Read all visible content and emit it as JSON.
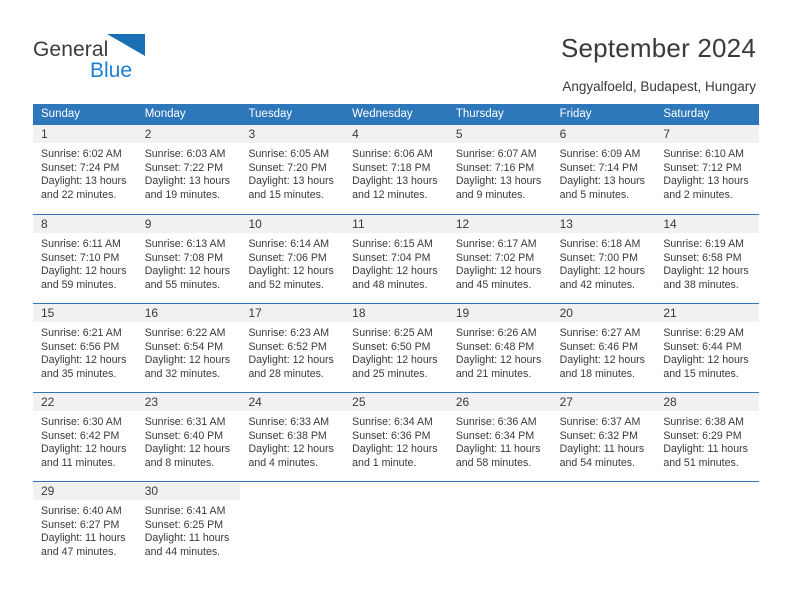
{
  "brand": {
    "name_part1": "General",
    "name_part2": "Blue",
    "logo_icon": "blue-triangle-icon",
    "accent_color": "#1b7fd4"
  },
  "header": {
    "title": "September 2024",
    "subtitle": "Angyalfoeld, Budapest, Hungary"
  },
  "colors": {
    "header_row_bg": "#2e77bb",
    "header_row_text": "#ffffff",
    "day_number_band_bg": "#f1f1f1",
    "cell_bg": "#ffffff",
    "text": "#3a3a3a"
  },
  "weekdays": [
    "Sunday",
    "Monday",
    "Tuesday",
    "Wednesday",
    "Thursday",
    "Friday",
    "Saturday"
  ],
  "weeks": [
    [
      {
        "day": "1",
        "sunrise": "Sunrise: 6:02 AM",
        "sunset": "Sunset: 7:24 PM",
        "daylight1": "Daylight: 13 hours",
        "daylight2": "and 22 minutes."
      },
      {
        "day": "2",
        "sunrise": "Sunrise: 6:03 AM",
        "sunset": "Sunset: 7:22 PM",
        "daylight1": "Daylight: 13 hours",
        "daylight2": "and 19 minutes."
      },
      {
        "day": "3",
        "sunrise": "Sunrise: 6:05 AM",
        "sunset": "Sunset: 7:20 PM",
        "daylight1": "Daylight: 13 hours",
        "daylight2": "and 15 minutes."
      },
      {
        "day": "4",
        "sunrise": "Sunrise: 6:06 AM",
        "sunset": "Sunset: 7:18 PM",
        "daylight1": "Daylight: 13 hours",
        "daylight2": "and 12 minutes."
      },
      {
        "day": "5",
        "sunrise": "Sunrise: 6:07 AM",
        "sunset": "Sunset: 7:16 PM",
        "daylight1": "Daylight: 13 hours",
        "daylight2": "and 9 minutes."
      },
      {
        "day": "6",
        "sunrise": "Sunrise: 6:09 AM",
        "sunset": "Sunset: 7:14 PM",
        "daylight1": "Daylight: 13 hours",
        "daylight2": "and 5 minutes."
      },
      {
        "day": "7",
        "sunrise": "Sunrise: 6:10 AM",
        "sunset": "Sunset: 7:12 PM",
        "daylight1": "Daylight: 13 hours",
        "daylight2": "and 2 minutes."
      }
    ],
    [
      {
        "day": "8",
        "sunrise": "Sunrise: 6:11 AM",
        "sunset": "Sunset: 7:10 PM",
        "daylight1": "Daylight: 12 hours",
        "daylight2": "and 59 minutes."
      },
      {
        "day": "9",
        "sunrise": "Sunrise: 6:13 AM",
        "sunset": "Sunset: 7:08 PM",
        "daylight1": "Daylight: 12 hours",
        "daylight2": "and 55 minutes."
      },
      {
        "day": "10",
        "sunrise": "Sunrise: 6:14 AM",
        "sunset": "Sunset: 7:06 PM",
        "daylight1": "Daylight: 12 hours",
        "daylight2": "and 52 minutes."
      },
      {
        "day": "11",
        "sunrise": "Sunrise: 6:15 AM",
        "sunset": "Sunset: 7:04 PM",
        "daylight1": "Daylight: 12 hours",
        "daylight2": "and 48 minutes."
      },
      {
        "day": "12",
        "sunrise": "Sunrise: 6:17 AM",
        "sunset": "Sunset: 7:02 PM",
        "daylight1": "Daylight: 12 hours",
        "daylight2": "and 45 minutes."
      },
      {
        "day": "13",
        "sunrise": "Sunrise: 6:18 AM",
        "sunset": "Sunset: 7:00 PM",
        "daylight1": "Daylight: 12 hours",
        "daylight2": "and 42 minutes."
      },
      {
        "day": "14",
        "sunrise": "Sunrise: 6:19 AM",
        "sunset": "Sunset: 6:58 PM",
        "daylight1": "Daylight: 12 hours",
        "daylight2": "and 38 minutes."
      }
    ],
    [
      {
        "day": "15",
        "sunrise": "Sunrise: 6:21 AM",
        "sunset": "Sunset: 6:56 PM",
        "daylight1": "Daylight: 12 hours",
        "daylight2": "and 35 minutes."
      },
      {
        "day": "16",
        "sunrise": "Sunrise: 6:22 AM",
        "sunset": "Sunset: 6:54 PM",
        "daylight1": "Daylight: 12 hours",
        "daylight2": "and 32 minutes."
      },
      {
        "day": "17",
        "sunrise": "Sunrise: 6:23 AM",
        "sunset": "Sunset: 6:52 PM",
        "daylight1": "Daylight: 12 hours",
        "daylight2": "and 28 minutes."
      },
      {
        "day": "18",
        "sunrise": "Sunrise: 6:25 AM",
        "sunset": "Sunset: 6:50 PM",
        "daylight1": "Daylight: 12 hours",
        "daylight2": "and 25 minutes."
      },
      {
        "day": "19",
        "sunrise": "Sunrise: 6:26 AM",
        "sunset": "Sunset: 6:48 PM",
        "daylight1": "Daylight: 12 hours",
        "daylight2": "and 21 minutes."
      },
      {
        "day": "20",
        "sunrise": "Sunrise: 6:27 AM",
        "sunset": "Sunset: 6:46 PM",
        "daylight1": "Daylight: 12 hours",
        "daylight2": "and 18 minutes."
      },
      {
        "day": "21",
        "sunrise": "Sunrise: 6:29 AM",
        "sunset": "Sunset: 6:44 PM",
        "daylight1": "Daylight: 12 hours",
        "daylight2": "and 15 minutes."
      }
    ],
    [
      {
        "day": "22",
        "sunrise": "Sunrise: 6:30 AM",
        "sunset": "Sunset: 6:42 PM",
        "daylight1": "Daylight: 12 hours",
        "daylight2": "and 11 minutes."
      },
      {
        "day": "23",
        "sunrise": "Sunrise: 6:31 AM",
        "sunset": "Sunset: 6:40 PM",
        "daylight1": "Daylight: 12 hours",
        "daylight2": "and 8 minutes."
      },
      {
        "day": "24",
        "sunrise": "Sunrise: 6:33 AM",
        "sunset": "Sunset: 6:38 PM",
        "daylight1": "Daylight: 12 hours",
        "daylight2": "and 4 minutes."
      },
      {
        "day": "25",
        "sunrise": "Sunrise: 6:34 AM",
        "sunset": "Sunset: 6:36 PM",
        "daylight1": "Daylight: 12 hours",
        "daylight2": "and 1 minute."
      },
      {
        "day": "26",
        "sunrise": "Sunrise: 6:36 AM",
        "sunset": "Sunset: 6:34 PM",
        "daylight1": "Daylight: 11 hours",
        "daylight2": "and 58 minutes."
      },
      {
        "day": "27",
        "sunrise": "Sunrise: 6:37 AM",
        "sunset": "Sunset: 6:32 PM",
        "daylight1": "Daylight: 11 hours",
        "daylight2": "and 54 minutes."
      },
      {
        "day": "28",
        "sunrise": "Sunrise: 6:38 AM",
        "sunset": "Sunset: 6:29 PM",
        "daylight1": "Daylight: 11 hours",
        "daylight2": "and 51 minutes."
      }
    ],
    [
      {
        "day": "29",
        "sunrise": "Sunrise: 6:40 AM",
        "sunset": "Sunset: 6:27 PM",
        "daylight1": "Daylight: 11 hours",
        "daylight2": "and 47 minutes."
      },
      {
        "day": "30",
        "sunrise": "Sunrise: 6:41 AM",
        "sunset": "Sunset: 6:25 PM",
        "daylight1": "Daylight: 11 hours",
        "daylight2": "and 44 minutes."
      },
      {
        "day": "",
        "sunrise": "",
        "sunset": "",
        "daylight1": "",
        "daylight2": ""
      },
      {
        "day": "",
        "sunrise": "",
        "sunset": "",
        "daylight1": "",
        "daylight2": ""
      },
      {
        "day": "",
        "sunrise": "",
        "sunset": "",
        "daylight1": "",
        "daylight2": ""
      },
      {
        "day": "",
        "sunrise": "",
        "sunset": "",
        "daylight1": "",
        "daylight2": ""
      },
      {
        "day": "",
        "sunrise": "",
        "sunset": "",
        "daylight1": "",
        "daylight2": ""
      }
    ]
  ]
}
